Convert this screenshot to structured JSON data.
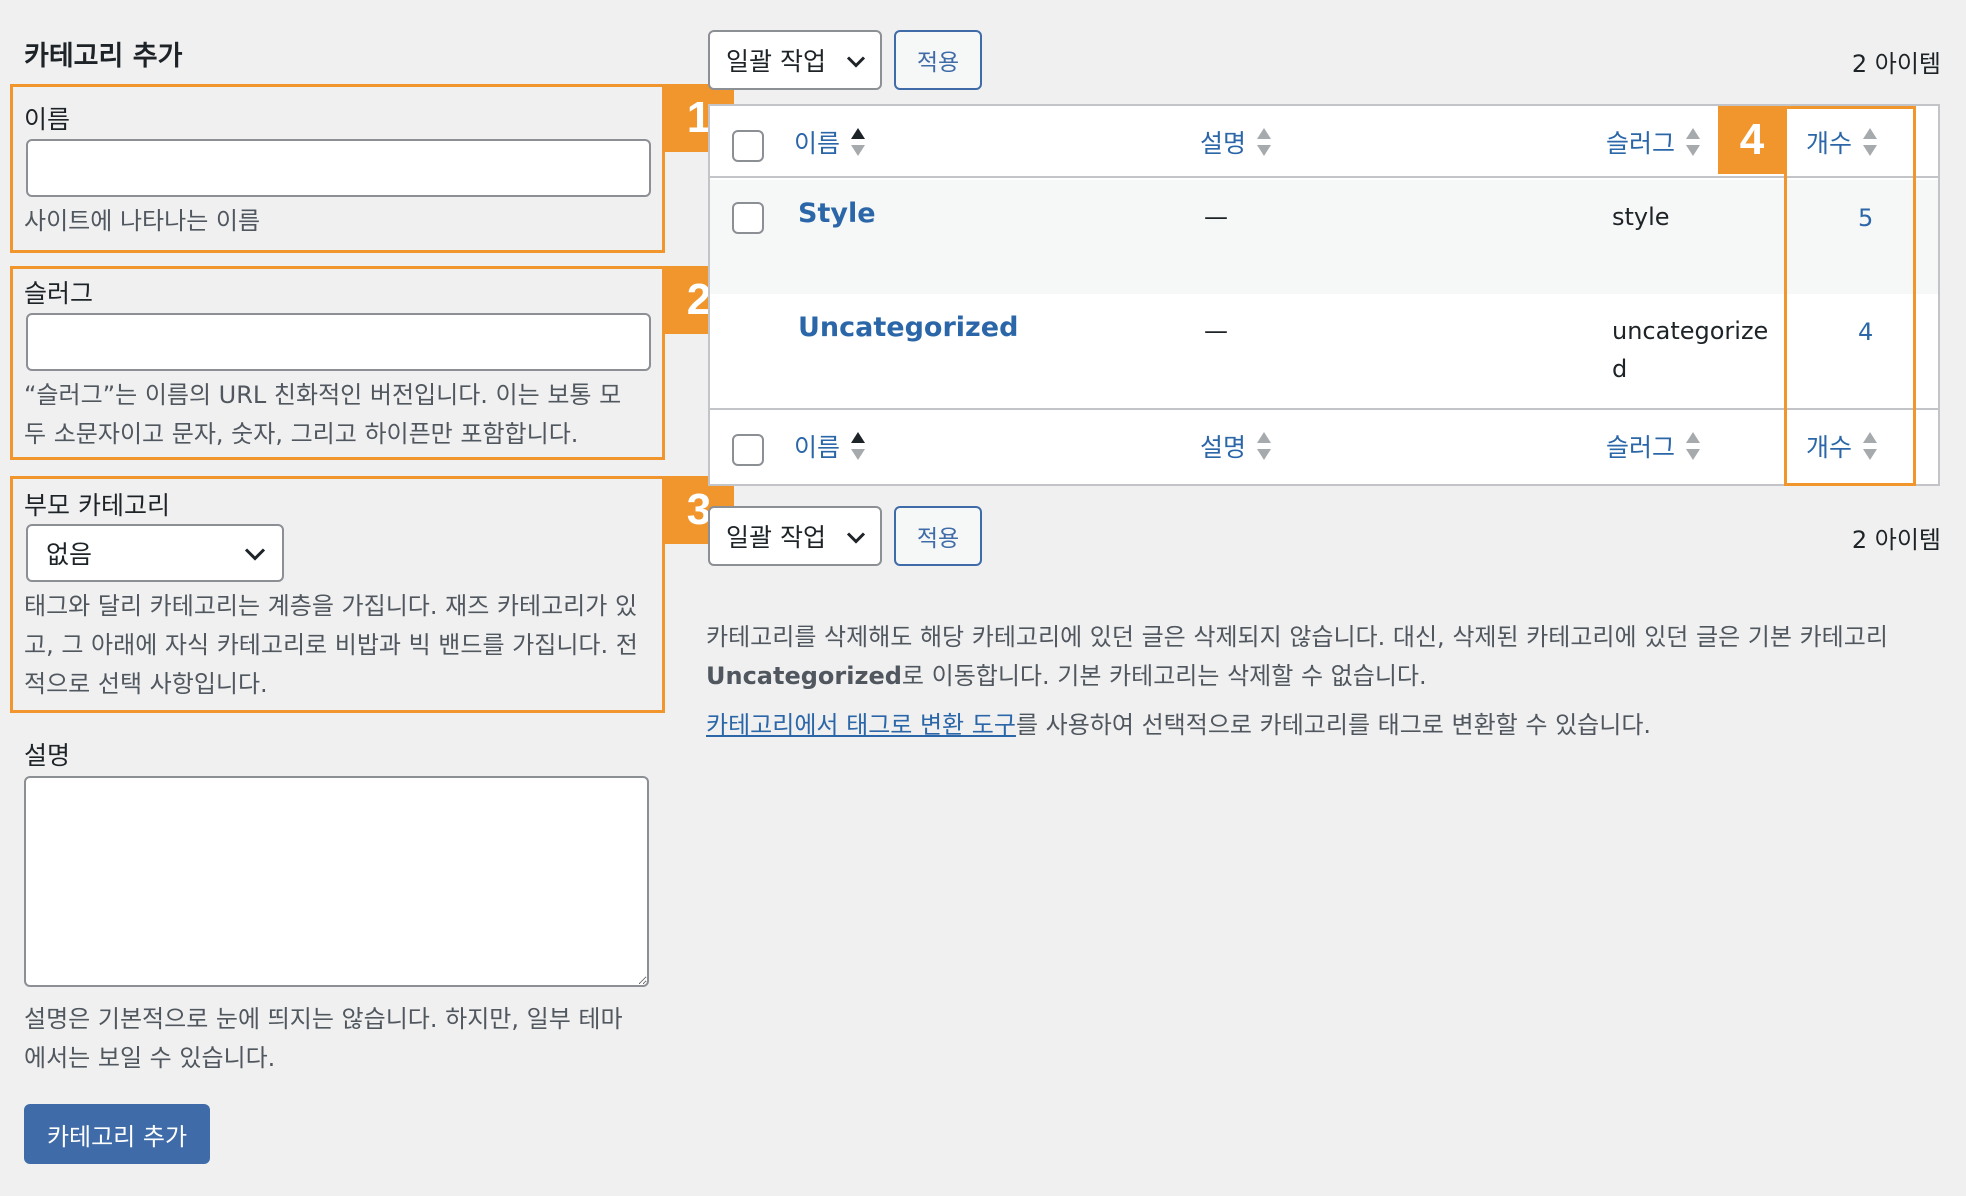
{
  "add_form": {
    "title": "카테고리 추가",
    "name": {
      "label": "이름",
      "value": "",
      "help": "사이트에 나타나는 이름"
    },
    "slug": {
      "label": "슬러그",
      "value": "",
      "help_line1": "“슬러그”는 이름의 URL 친화적인 버전입니다. 이는 보통 모",
      "help_line2": "두 소문자이고 문자, 숫자, 그리고 하이픈만 포함합니다."
    },
    "parent": {
      "label": "부모 카테고리",
      "selected": "없음",
      "help_line1": "태그와 달리 카테고리는 계층을 가집니다. 재즈 카테고리가 있",
      "help_line2": "고, 그 아래에 자식 카테고리로 비밥과 빅 밴드를 가집니다. 전",
      "help_line3": "적으로 선택 사항입니다."
    },
    "description": {
      "label": "설명",
      "value": "",
      "help_line1": "설명은 기본적으로 눈에 띄지는 않습니다. 하지만, 일부 테마",
      "help_line2": "에서는 보일 수 있습니다."
    },
    "submit_label": "카테고리 추가"
  },
  "callouts": [
    "1",
    "2",
    "3",
    "4"
  ],
  "list": {
    "bulk_action": "일괄 작업",
    "apply_label": "적용",
    "item_count": "2 아이템",
    "columns": {
      "name": "이름",
      "description": "설명",
      "slug": "슬러그",
      "count": "개수"
    },
    "rows": [
      {
        "name": "Style",
        "description": "—",
        "slug": "style",
        "count": "5"
      },
      {
        "name": "Uncategorized",
        "description": "—",
        "slug_line1": "uncategorize",
        "slug_line2": "d",
        "count": "4"
      }
    ]
  },
  "notes": {
    "line1": "카테고리를 삭제해도 해당 카테고리에 있던 글은 삭제되지 않습니다. 대신, 삭제된 카테고리에 있던 글은 기본 카테고리",
    "line2_bold": "Uncategorized",
    "line2_rest": "로 이동합니다. 기본 카테고리는 삭제할 수 없습니다.",
    "link_text": "카테고리에서 태그로 변환 도구",
    "line3_rest": "를 사용하여 선택적으로 카테고리를 태그로 변환할 수 있습니다."
  },
  "colors": {
    "accent": "#2b67a8",
    "callout": "#f0962d",
    "primary_button": "#3f6ca8",
    "background": "#f0f0f1"
  }
}
